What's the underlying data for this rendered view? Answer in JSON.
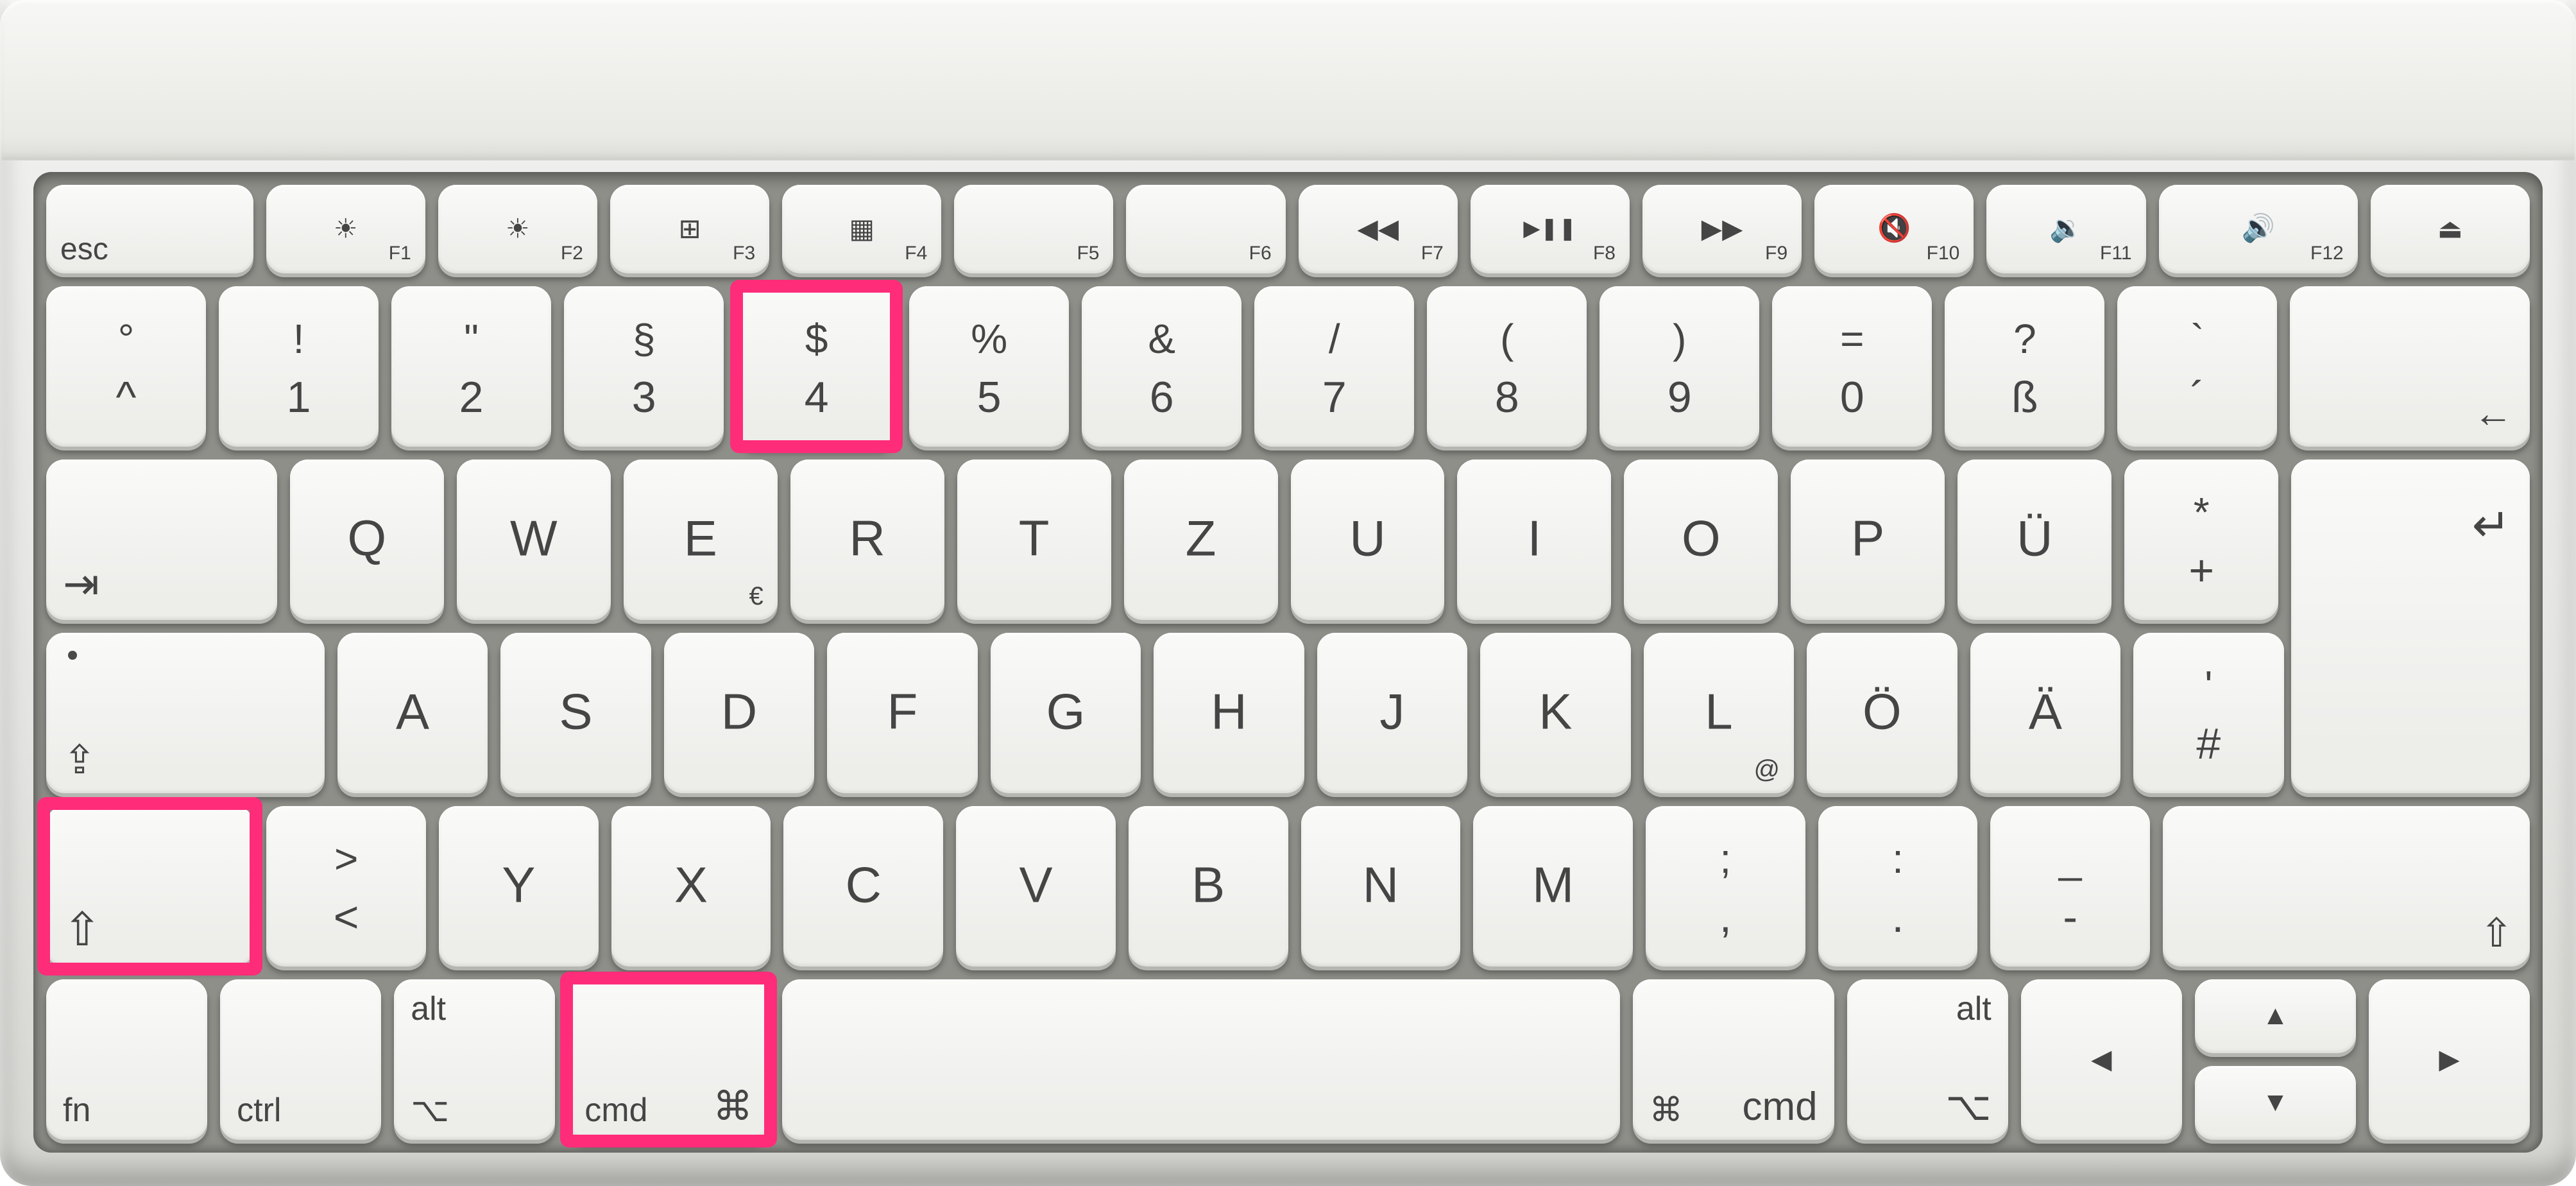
{
  "description": "Apple German (QWERTZ) wireless keyboard with three keys highlighted for the screenshot shortcut: Shift, Command, and 4.",
  "highlighted_shortcut": "⇧ + ⌘ + 4",
  "fn_row": [
    {
      "label": "esc",
      "icon": "",
      "sub": ""
    },
    {
      "label": "",
      "icon": "☀︎",
      "sub": "F1",
      "desc": "brightness-down"
    },
    {
      "label": "",
      "icon": "☀",
      "sub": "F2",
      "desc": "brightness-up"
    },
    {
      "label": "",
      "icon": "⊞",
      "sub": "F3",
      "desc": "mission-control"
    },
    {
      "label": "",
      "icon": "▦",
      "sub": "F4",
      "desc": "launchpad"
    },
    {
      "label": "",
      "icon": "",
      "sub": "F5"
    },
    {
      "label": "",
      "icon": "",
      "sub": "F6"
    },
    {
      "label": "",
      "icon": "◀◀",
      "sub": "F7",
      "desc": "rewind"
    },
    {
      "label": "",
      "icon": "▶❚❚",
      "sub": "F8",
      "desc": "play-pause"
    },
    {
      "label": "",
      "icon": "▶▶",
      "sub": "F9",
      "desc": "fast-forward"
    },
    {
      "label": "",
      "icon": "🔇",
      "sub": "F10",
      "desc": "mute"
    },
    {
      "label": "",
      "icon": "🔉",
      "sub": "F11",
      "desc": "volume-down"
    },
    {
      "label": "",
      "icon": "🔊",
      "sub": "F12",
      "desc": "volume-up"
    },
    {
      "label": "",
      "icon": "⏏",
      "sub": "",
      "desc": "eject"
    }
  ],
  "num_row": [
    {
      "top": "°",
      "bot": "^"
    },
    {
      "top": "!",
      "bot": "1"
    },
    {
      "top": "\"",
      "bot": "2"
    },
    {
      "top": "§",
      "bot": "3"
    },
    {
      "top": "$",
      "bot": "4",
      "highlight": true
    },
    {
      "top": "%",
      "bot": "5"
    },
    {
      "top": "&",
      "bot": "6"
    },
    {
      "top": "/",
      "bot": "7"
    },
    {
      "top": "(",
      "bot": "8"
    },
    {
      "top": ")",
      "bot": "9"
    },
    {
      "top": "=",
      "bot": "0"
    },
    {
      "top": "?",
      "bot": "ß"
    },
    {
      "top": "`",
      "bot": "´"
    }
  ],
  "backspace": "←",
  "tab": "⇥",
  "q_row": [
    {
      "c": "Q"
    },
    {
      "c": "W"
    },
    {
      "c": "E",
      "br": "€"
    },
    {
      "c": "R"
    },
    {
      "c": "T"
    },
    {
      "c": "Z"
    },
    {
      "c": "U"
    },
    {
      "c": "I"
    },
    {
      "c": "O"
    },
    {
      "c": "P"
    },
    {
      "c": "Ü"
    },
    {
      "top": "*",
      "bot": "+"
    }
  ],
  "enter": "↵",
  "caps": "⇪",
  "a_row": [
    {
      "c": "A"
    },
    {
      "c": "S"
    },
    {
      "c": "D"
    },
    {
      "c": "F"
    },
    {
      "c": "G"
    },
    {
      "c": "H"
    },
    {
      "c": "J"
    },
    {
      "c": "K"
    },
    {
      "c": "L",
      "br": "@"
    },
    {
      "c": "Ö"
    },
    {
      "c": "Ä"
    },
    {
      "top": "'",
      "bot": "#"
    }
  ],
  "shift_l": "⇧",
  "lt_gt": {
    "top": ">",
    "bot": "<"
  },
  "y_row": [
    {
      "c": "Y"
    },
    {
      "c": "X"
    },
    {
      "c": "C"
    },
    {
      "c": "V"
    },
    {
      "c": "B"
    },
    {
      "c": "N"
    },
    {
      "c": "M"
    },
    {
      "top": ";",
      "bot": ","
    },
    {
      "top": ":",
      "bot": "."
    },
    {
      "top": "_",
      "bot": "-"
    }
  ],
  "shift_r": "⇧",
  "bottom": {
    "fn": "fn",
    "ctrl": "ctrl",
    "alt_l_top": "alt",
    "alt_l_sym": "⌥",
    "cmd_l": "cmd",
    "cmd_sym": "⌘",
    "cmd_r": "cmd",
    "alt_r_top": "alt",
    "alt_r_sym": "⌥"
  },
  "arrows": {
    "up": "▲",
    "down": "▼",
    "left": "◀",
    "right": "▶"
  },
  "highlights": [
    "shift-left-key",
    "cmd-left-key",
    "key-4"
  ]
}
